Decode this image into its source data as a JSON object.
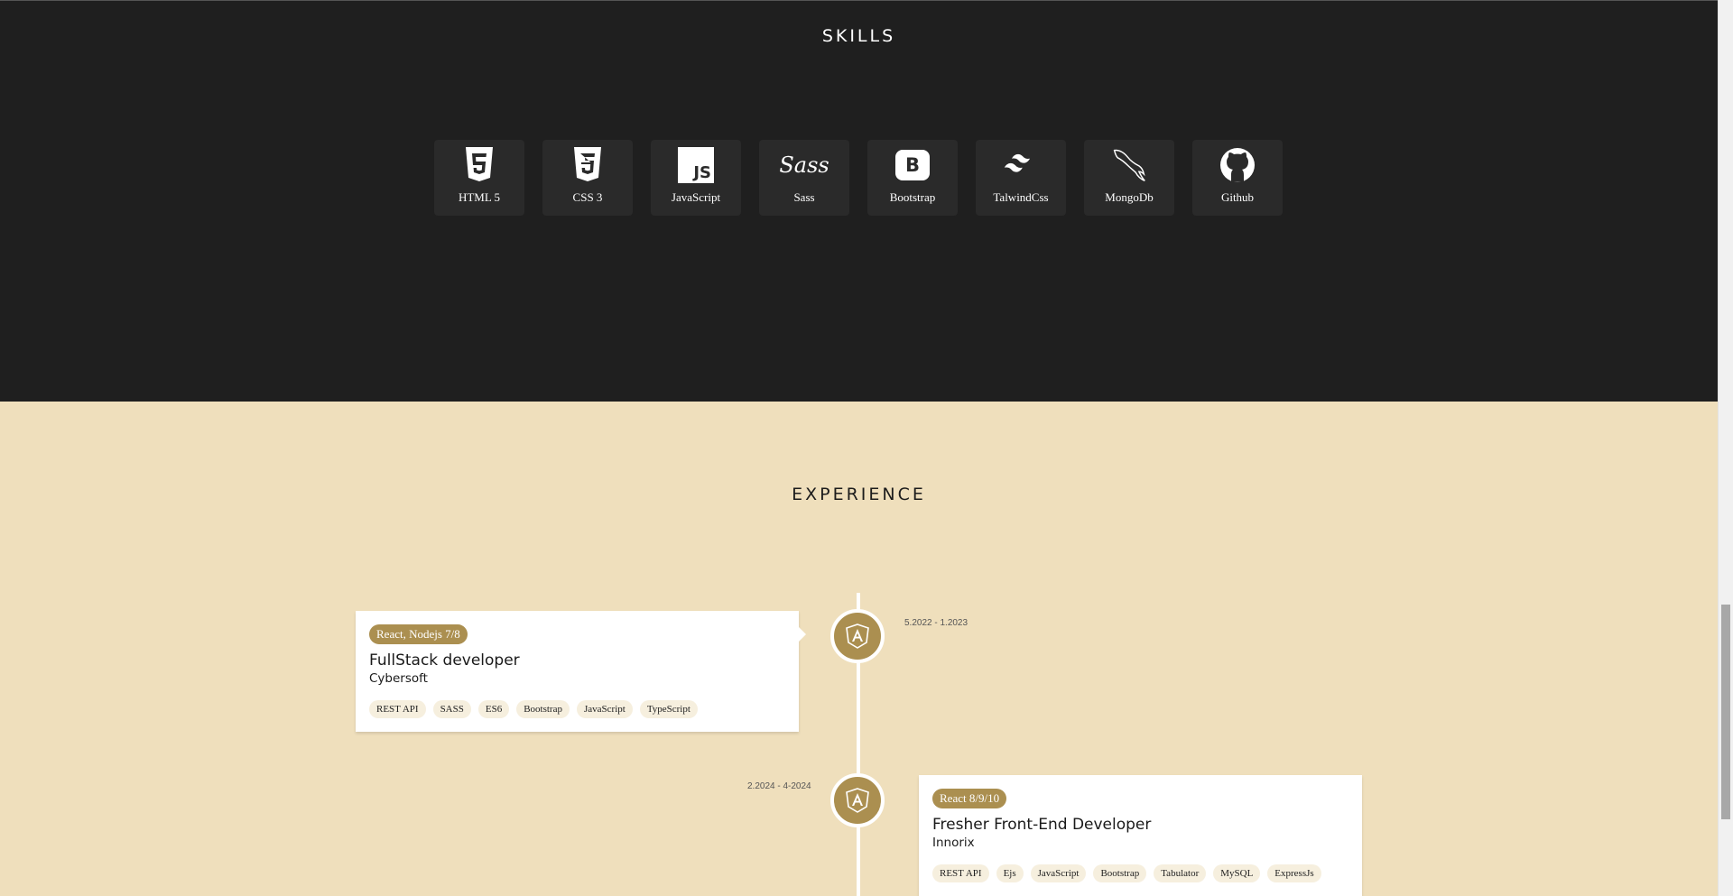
{
  "skills": {
    "title": "SKILLS",
    "items": [
      {
        "label": "HTML  5",
        "icon": "html5-icon"
      },
      {
        "label": "CSS  3",
        "icon": "css3-icon"
      },
      {
        "label": "JavaScript",
        "icon": "javascript-icon"
      },
      {
        "label": "Sass",
        "icon": "sass-icon"
      },
      {
        "label": "Bootstrap",
        "icon": "bootstrap-icon"
      },
      {
        "label": "TalwindCss",
        "icon": "tailwind-icon"
      },
      {
        "label": "MongoDb",
        "icon": "mysql-dolphin-icon"
      },
      {
        "label": "Github",
        "icon": "github-icon"
      }
    ],
    "js_badge": "JS",
    "bootstrap_badge": "B",
    "sass_text": "Sass"
  },
  "experience": {
    "title": "EXPERIENCE",
    "items": [
      {
        "badge": "React, Nodejs 7/8",
        "job_title": "FullStack developer",
        "company": "Cybersoft",
        "date": "5.2022 - 1.2023",
        "tags": [
          "REST API",
          "SASS",
          "ES6",
          "Bootstrap",
          "JavaScript",
          "TypeScript"
        ],
        "icon": "angular-icon"
      },
      {
        "badge": "React 8/9/10",
        "job_title": "Fresher Front-End Developer",
        "company": "Innorix",
        "date": "2.2024 - 4-2024",
        "tags": [
          "REST API",
          "Ejs",
          "JavaScript",
          "Bootstrap",
          "Tabulator",
          "MySQL",
          "ExpressJs"
        ],
        "icon": "angular-icon"
      }
    ]
  },
  "colors": {
    "dark_bg": "#1f1f1f",
    "card_bg": "#2a2a2a",
    "beige_bg": "#efdfbc",
    "accent": "#ab8f50"
  }
}
